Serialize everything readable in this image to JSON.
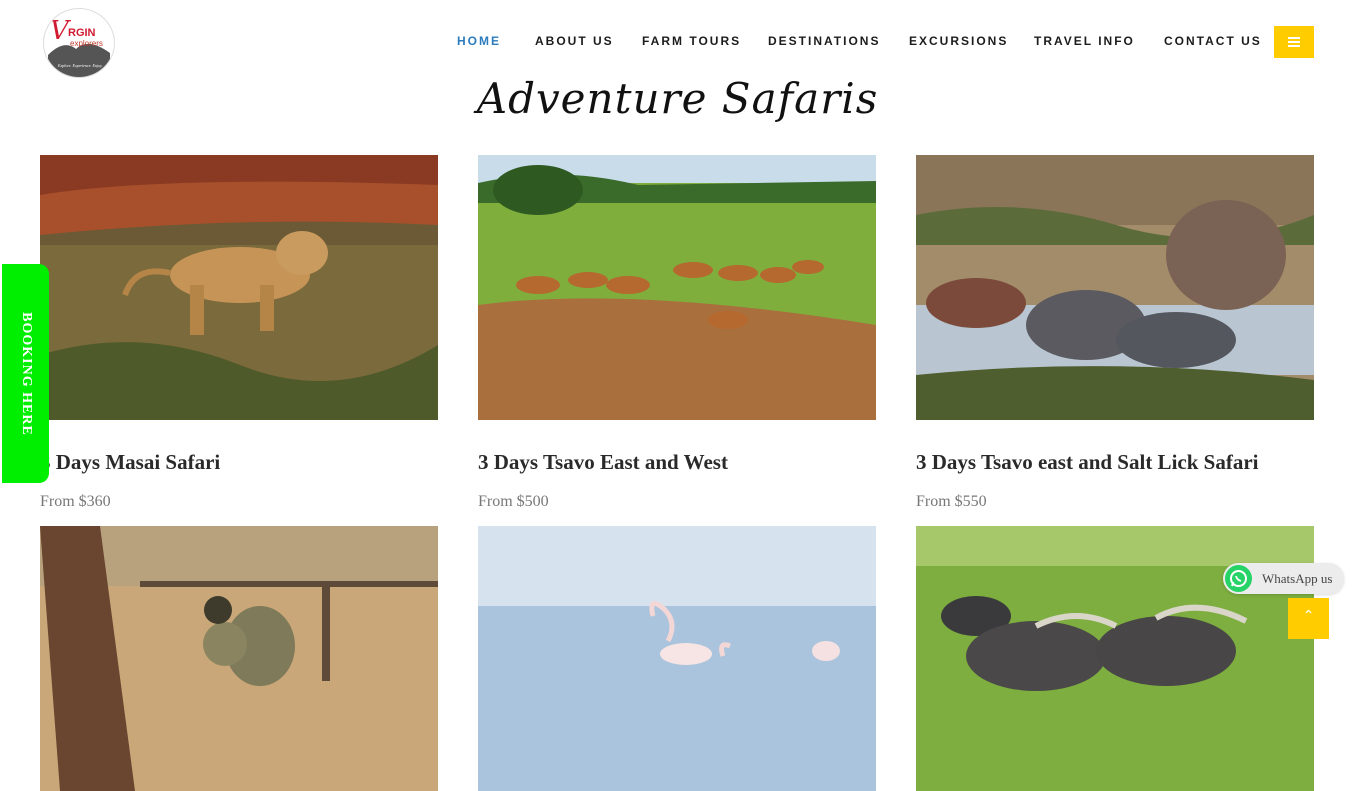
{
  "logo": {
    "text_top": "V",
    "text_brand": "RGIN",
    "text_sub": "explorers",
    "tagline": "Explore. Experience. Enjoy."
  },
  "nav": {
    "items": [
      "HOME",
      "ABOUT US",
      "FARM TOURS",
      "DESTINATIONS",
      "EXCURSIONS",
      "TRAVEL INFO",
      "CONTACT US"
    ],
    "active": "HOME",
    "menu_icon": "hamburger-icon"
  },
  "page_title": "Adventure Safaris",
  "tours": [
    {
      "name": "3 Days Masai Safari",
      "price": "From $360",
      "image": "lioness"
    },
    {
      "name": "3 Days Tsavo East and West",
      "price": "From $500",
      "image": "impalas"
    },
    {
      "name": "3 Days Tsavo east and Salt Lick Safari",
      "price": "From $550",
      "image": "elephants"
    },
    {
      "image": "monkeys"
    },
    {
      "image": "flamingos"
    },
    {
      "image": "buffaloes"
    }
  ],
  "booking_tab": {
    "label": "BOOKING HERE"
  },
  "whatsapp": {
    "label": "WhatsApp us",
    "icon": "whatsapp-icon"
  },
  "back_to_top": {
    "icon": "chevron-up-icon",
    "glyph": "⌃"
  },
  "colors": {
    "accent": "#ffcc00",
    "nav_active": "#2b7bbd",
    "booking": "#00ee00",
    "whatsapp": "#25d366"
  }
}
